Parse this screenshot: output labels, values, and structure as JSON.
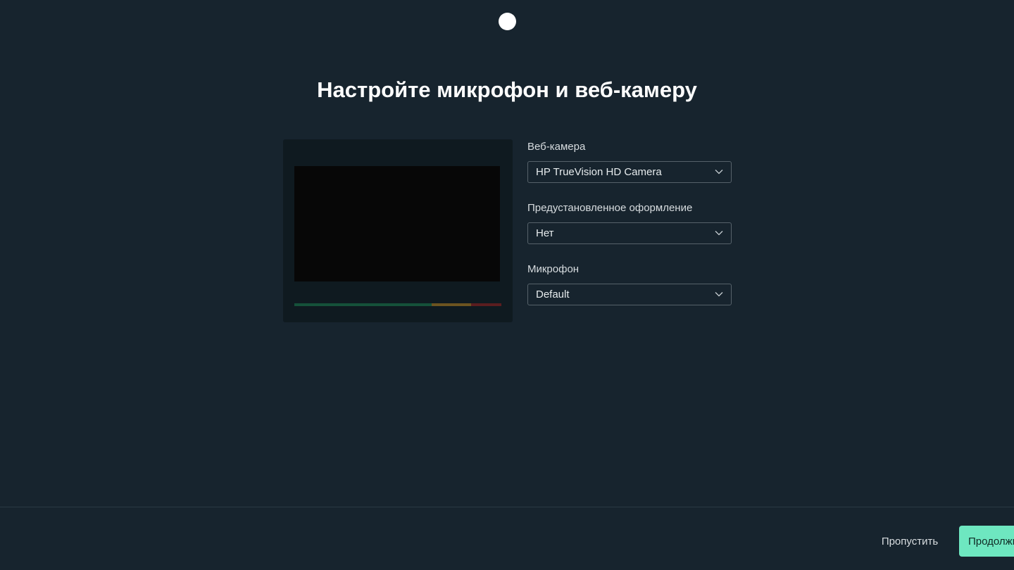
{
  "page": {
    "title": "Настройте микрофон и веб-камеру"
  },
  "preview": {
    "mic_level_fraction": 0.0
  },
  "settings": {
    "webcam": {
      "label": "Веб-камера",
      "value": "HP TrueVision HD Camera",
      "icon": "chevron-down-icon"
    },
    "preset": {
      "label": "Предустановленное оформление",
      "value": "Нет",
      "icon": "chevron-down-icon"
    },
    "microphone": {
      "label": "Микрофон",
      "value": "Default",
      "icon": "chevron-down-icon"
    }
  },
  "footer": {
    "skip_label": "Пропустить",
    "continue_label": "Продолжить"
  },
  "colors": {
    "background": "#17242e",
    "accent": "#6ee7c0",
    "meter_green": "#15513a",
    "meter_yellow": "#6c5420",
    "meter_red": "#5a1d1f"
  }
}
